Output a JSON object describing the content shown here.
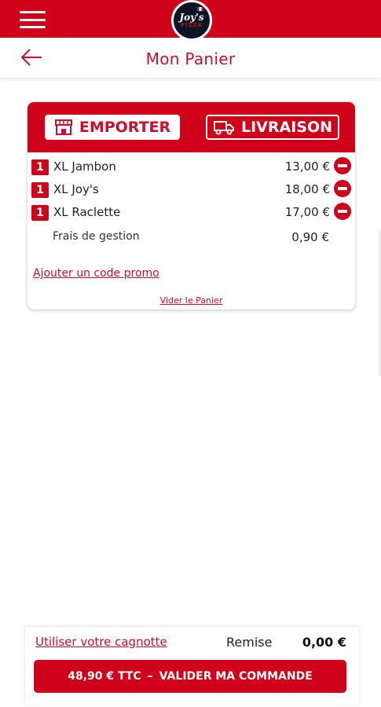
{
  "app": {
    "logo_text": "Joy's",
    "logo_subtext": "PIZZA"
  },
  "header": {
    "title": "Mon Panier"
  },
  "mode": {
    "emporter_label": "EMPORTER",
    "livraison_label": "LIVRAISON",
    "selected": "EMPORTER"
  },
  "cart": {
    "items": [
      {
        "qty": "1",
        "name": "XL Jambon",
        "price": "13,00 €"
      },
      {
        "qty": "1",
        "name": "XL Joy's",
        "price": "18,00 €"
      },
      {
        "qty": "1",
        "name": "XL Raclette",
        "price": "17,00 €"
      }
    ],
    "fee": {
      "label": "Frais de gestion",
      "price": "0,90 €"
    },
    "promo_link": "Ajouter un code promo",
    "empty_link": "Vider le Panier"
  },
  "footer": {
    "cagnotte_link": "Utiliser votre cagnotte",
    "remise_label": "Remise",
    "remise_value": "0,00 €",
    "total": "48,90 € TTC",
    "separator": "–",
    "validate_label": "VALIDER MA COMMANDE"
  },
  "colors": {
    "brand_red": "#d0021b",
    "text_dark": "#222222",
    "background": "#ffffff"
  }
}
